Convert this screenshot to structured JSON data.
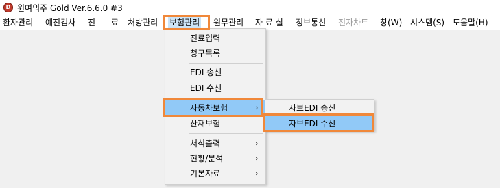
{
  "titlebar": {
    "icon_letter": "D",
    "title": "윈여의주 Gold Ver.6.6.0 #3"
  },
  "menubar": {
    "items": [
      {
        "label": "환자관리"
      },
      {
        "label": "예진검사"
      },
      {
        "label": "진"
      },
      {
        "label": "료"
      },
      {
        "label": "처방관리"
      },
      {
        "label": "보험관리"
      },
      {
        "label": "원무관리"
      },
      {
        "label": "자 료 실"
      },
      {
        "label": "정보통신"
      },
      {
        "label": "전자차트"
      },
      {
        "label": "창(W)"
      },
      {
        "label": "시스템(S)"
      },
      {
        "label": "도움말(H)"
      }
    ]
  },
  "insurance_menu": {
    "items": [
      {
        "label": "진료입력"
      },
      {
        "label": "청구목록"
      },
      {
        "label": "EDI 송신"
      },
      {
        "label": "EDI 수신"
      },
      {
        "label": "자동차보험",
        "arrow": "›"
      },
      {
        "label": "산재보험"
      },
      {
        "label": "서식출력",
        "arrow": "›"
      },
      {
        "label": "현황/분석",
        "arrow": "›"
      },
      {
        "label": "기본자료",
        "arrow": "›"
      }
    ]
  },
  "auto_insurance_submenu": {
    "items": [
      {
        "label": "자보EDI 송신"
      },
      {
        "label": "자보EDI 수신"
      }
    ]
  },
  "colors": {
    "highlight_box": "#f0883a",
    "selected_item": "#91c9f7",
    "disabled_text": "#9a9a9a"
  }
}
